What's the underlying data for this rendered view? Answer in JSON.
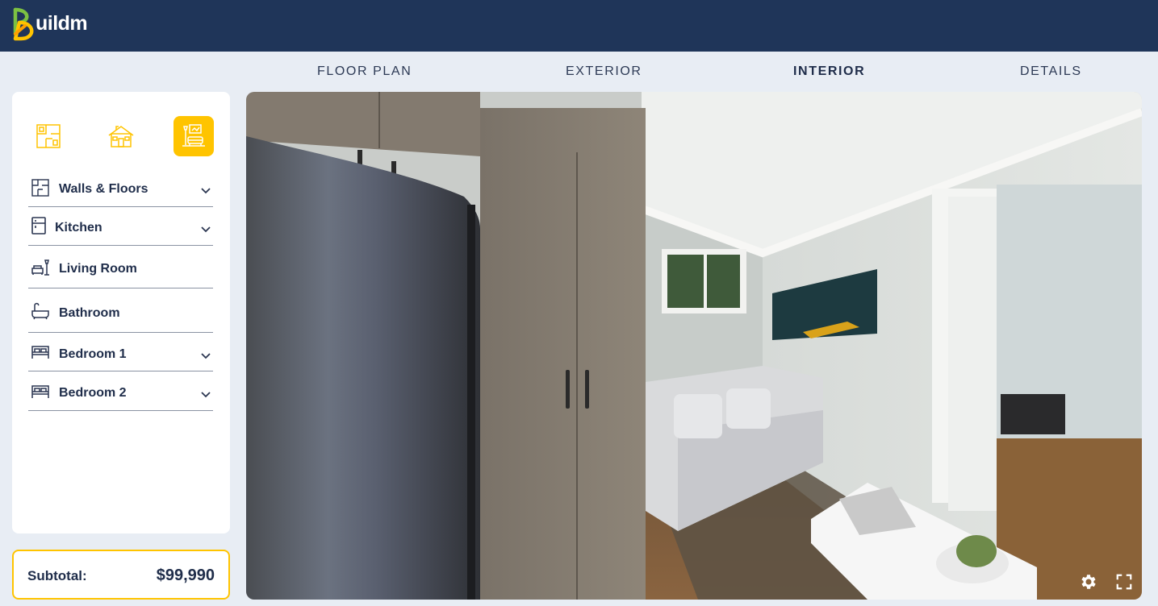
{
  "brand": {
    "logo_text": "uildm"
  },
  "tabs": [
    {
      "label": "FLOOR PLAN",
      "active": false
    },
    {
      "label": "EXTERIOR",
      "active": false
    },
    {
      "label": "INTERIOR",
      "active": true
    },
    {
      "label": "DETAILS",
      "active": false
    }
  ],
  "modes": [
    {
      "icon": "floor-plan-icon",
      "active": false
    },
    {
      "icon": "house-exterior-icon",
      "active": false
    },
    {
      "icon": "interior-room-icon",
      "active": true
    }
  ],
  "categories": [
    {
      "label": "Walls & Floors",
      "icon": "walls-floors-icon",
      "expandable": true
    },
    {
      "label": "Kitchen",
      "icon": "kitchen-icon",
      "expandable": true
    },
    {
      "label": "Living Room",
      "icon": "living-room-icon",
      "expandable": false
    },
    {
      "label": "Bathroom",
      "icon": "bathtub-icon",
      "expandable": false
    },
    {
      "label": "Bedroom 1",
      "icon": "bed-icon",
      "expandable": true
    },
    {
      "label": "Bedroom 2",
      "icon": "bed-icon",
      "expandable": true
    }
  ],
  "subtotal": {
    "label": "Subtotal:",
    "value": "$99,990"
  },
  "viewer": {
    "settings_icon": "gear-icon",
    "fullscreen_icon": "fullscreen-icon"
  },
  "colors": {
    "navy": "#1f3559",
    "accent": "#ffc400",
    "background": "#e8edf4"
  }
}
